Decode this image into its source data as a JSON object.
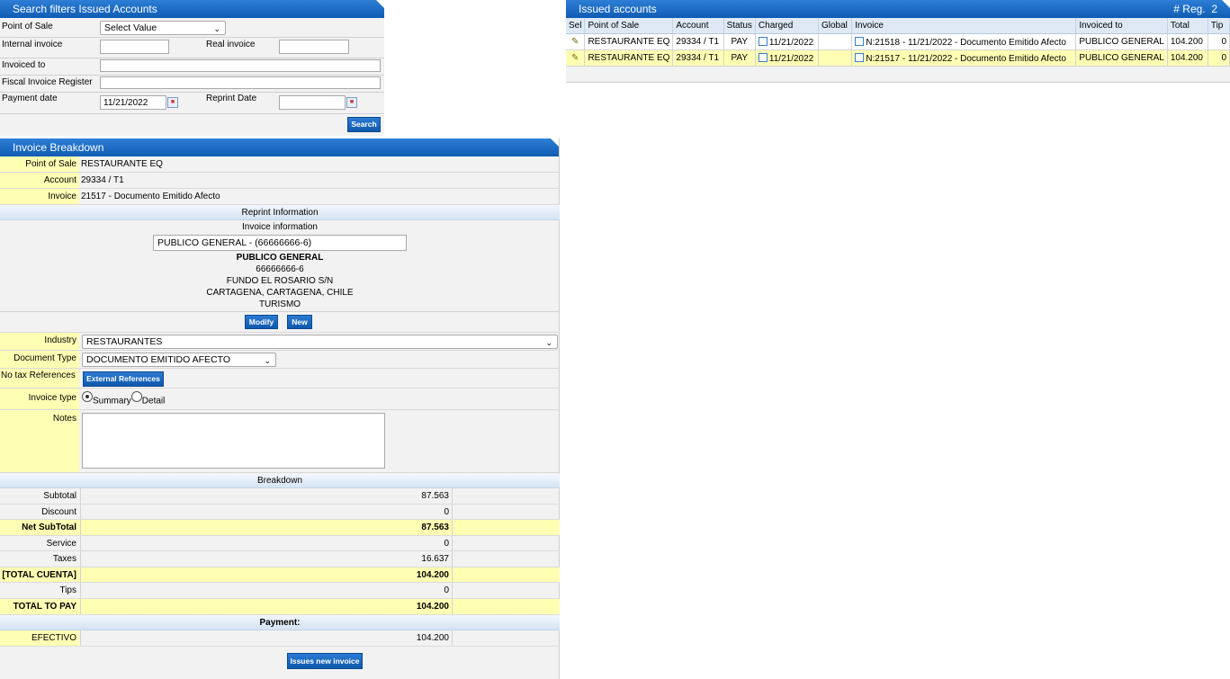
{
  "search": {
    "title": "Search filters Issued Accounts",
    "point_of_sale_label": "Point of Sale",
    "point_of_sale_value": "Select Value",
    "internal_invoice_label": "Internal invoice",
    "real_invoice_label": "Real invoice",
    "invoiced_to_label": "Invoiced to",
    "fiscal_register_label": "Fiscal Invoice Register",
    "payment_date_label": "Payment date",
    "payment_date_value": "11/21/2022",
    "reprint_date_label": "Reprint Date",
    "search_button": "Search"
  },
  "issued": {
    "title": "Issued accounts",
    "reg_label": "# Reg.",
    "reg_count": "2",
    "columns": [
      "Sel",
      "Point of Sale",
      "Account",
      "Status",
      "Charged",
      "Global",
      "Invoice",
      "Invoiced to",
      "Total",
      "Tip"
    ],
    "rows": [
      {
        "pos": "RESTAURANTE EQ",
        "account": "29334 / T1",
        "status": "PAY",
        "charged": "11/21/2022",
        "global": "",
        "invoice": "N:21518 - 11/21/2022 - Documento Emitido Afecto",
        "invoiced_to": "PUBLICO GENERAL",
        "total": "104.200",
        "tip": "0"
      },
      {
        "pos": "RESTAURANTE EQ",
        "account": "29334 / T1",
        "status": "PAY",
        "charged": "11/21/2022",
        "global": "",
        "invoice": "N:21517 - 11/21/2022 - Documento Emitido Afecto",
        "invoiced_to": "PUBLICO GENERAL",
        "total": "104.200",
        "tip": "0"
      }
    ]
  },
  "breakdown": {
    "title": "Invoice Breakdown",
    "pos_label": "Point of Sale",
    "pos_value": "RESTAURANTE EQ",
    "account_label": "Account",
    "account_value": "29334 / T1",
    "invoice_label": "Invoice",
    "invoice_value": "21517 - Documento Emitido Afecto",
    "reprint_section": "Reprint Information",
    "invoice_info_label": "Invoice information",
    "client_select": "PUBLICO GENERAL - (66666666-6)",
    "client_name": "PUBLICO GENERAL",
    "client_id": "66666666-6",
    "client_address": "FUNDO EL ROSARIO S/N",
    "client_city": "CARTAGENA, CARTAGENA, CHILE",
    "client_activity": "TURISMO",
    "modify_button": "Modify",
    "new_button": "New",
    "industry_label": "Industry",
    "industry_value": "RESTAURANTES",
    "doc_type_label": "Document Type",
    "doc_type_value": "DOCUMENTO EMITIDO AFECTO",
    "no_tax_label": "No tax References",
    "external_refs_button": "External References",
    "invoice_type_label": "Invoice type",
    "summary_label": "Summary",
    "detail_label": "Detail",
    "notes_label": "Notes",
    "breakdown_section": "Breakdown",
    "subtotal_label": "Subtotal",
    "subtotal": "87.563",
    "discount_label": "Discount",
    "discount": "0",
    "net_subtotal_label": "Net SubTotal",
    "net_subtotal": "87.563",
    "service_label": "Service",
    "service": "0",
    "taxes_label": "Taxes",
    "taxes": "16.637",
    "total_cuenta_label": "[TOTAL CUENTA]",
    "total_cuenta": "104.200",
    "tips_label": "Tips",
    "tips": "0",
    "total_pay_label": "TOTAL TO PAY",
    "total_pay": "104.200",
    "payment_section": "Payment:",
    "efectivo_label": "EFECTIVO",
    "efectivo": "104.200",
    "issue_button": "Issues new invoice"
  }
}
